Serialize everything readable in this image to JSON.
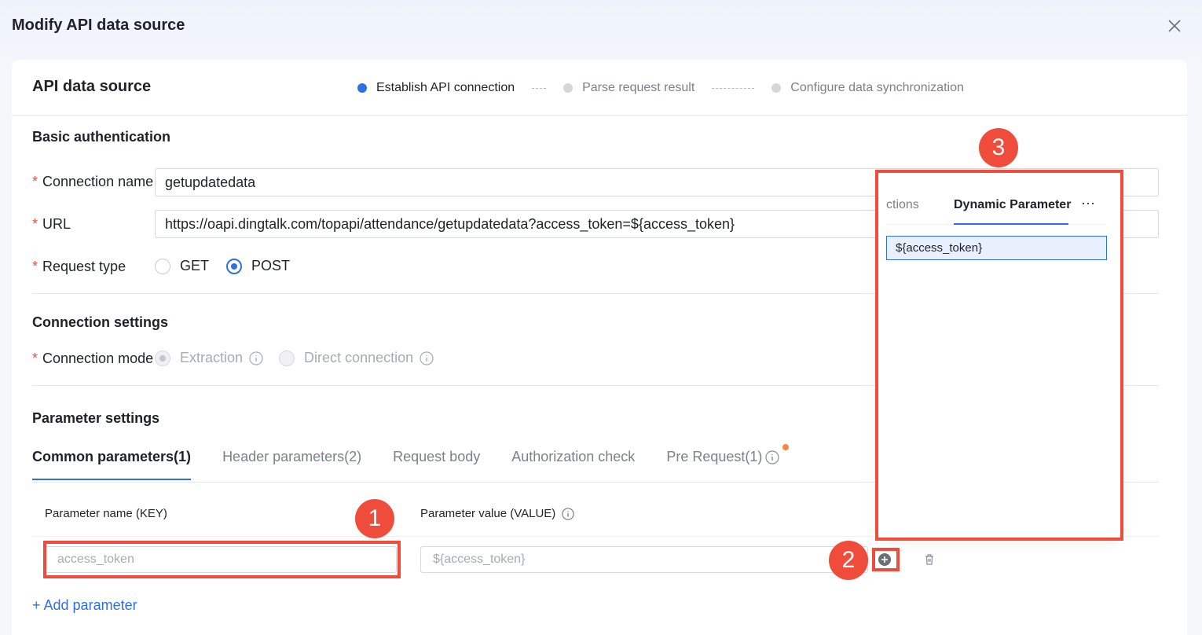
{
  "dialog": {
    "title": "Modify API data source"
  },
  "card": {
    "title": "API data source"
  },
  "steps": [
    {
      "label": "Establish API connection",
      "active": true
    },
    {
      "label": "Parse request result",
      "active": false
    },
    {
      "label": "Configure data synchronization",
      "active": false
    }
  ],
  "basic": {
    "title": "Basic authentication",
    "connection_name": {
      "label": "Connection name",
      "value": "getupdatedata"
    },
    "url": {
      "label": "URL",
      "value": "https://oapi.dingtalk.com/topapi/attendance/getupdatedata?access_token=${access_token}"
    },
    "request_type": {
      "label": "Request type",
      "options": [
        "GET",
        "POST"
      ],
      "selected": "POST"
    }
  },
  "connection": {
    "title": "Connection settings",
    "mode": {
      "label": "Connection mode",
      "options": [
        "Extraction",
        "Direct connection"
      ],
      "selected": "Extraction"
    }
  },
  "parameters": {
    "title": "Parameter settings",
    "tabs": [
      "Common parameters(1)",
      "Header parameters(2)",
      "Request body",
      "Authorization check",
      "Pre Request(1)"
    ],
    "active_tab": "Common parameters(1)",
    "columns": {
      "key": "Parameter name (KEY)",
      "value": "Parameter value (VALUE)"
    },
    "rows": [
      {
        "key": "access_token",
        "value": "${access_token}"
      }
    ],
    "add_label": "+ Add parameter"
  },
  "popup": {
    "tabs": [
      "ctions",
      "Dynamic Parameter"
    ],
    "active_tab": "Dynamic Parameter",
    "more": "···",
    "items": [
      "${access_token}"
    ]
  },
  "annotations": [
    "1",
    "2",
    "3"
  ],
  "colors": {
    "accent": "#2f6fe6",
    "annotation": "#ef4c3c",
    "required": "#e9524a",
    "badge": "#f5883b"
  }
}
